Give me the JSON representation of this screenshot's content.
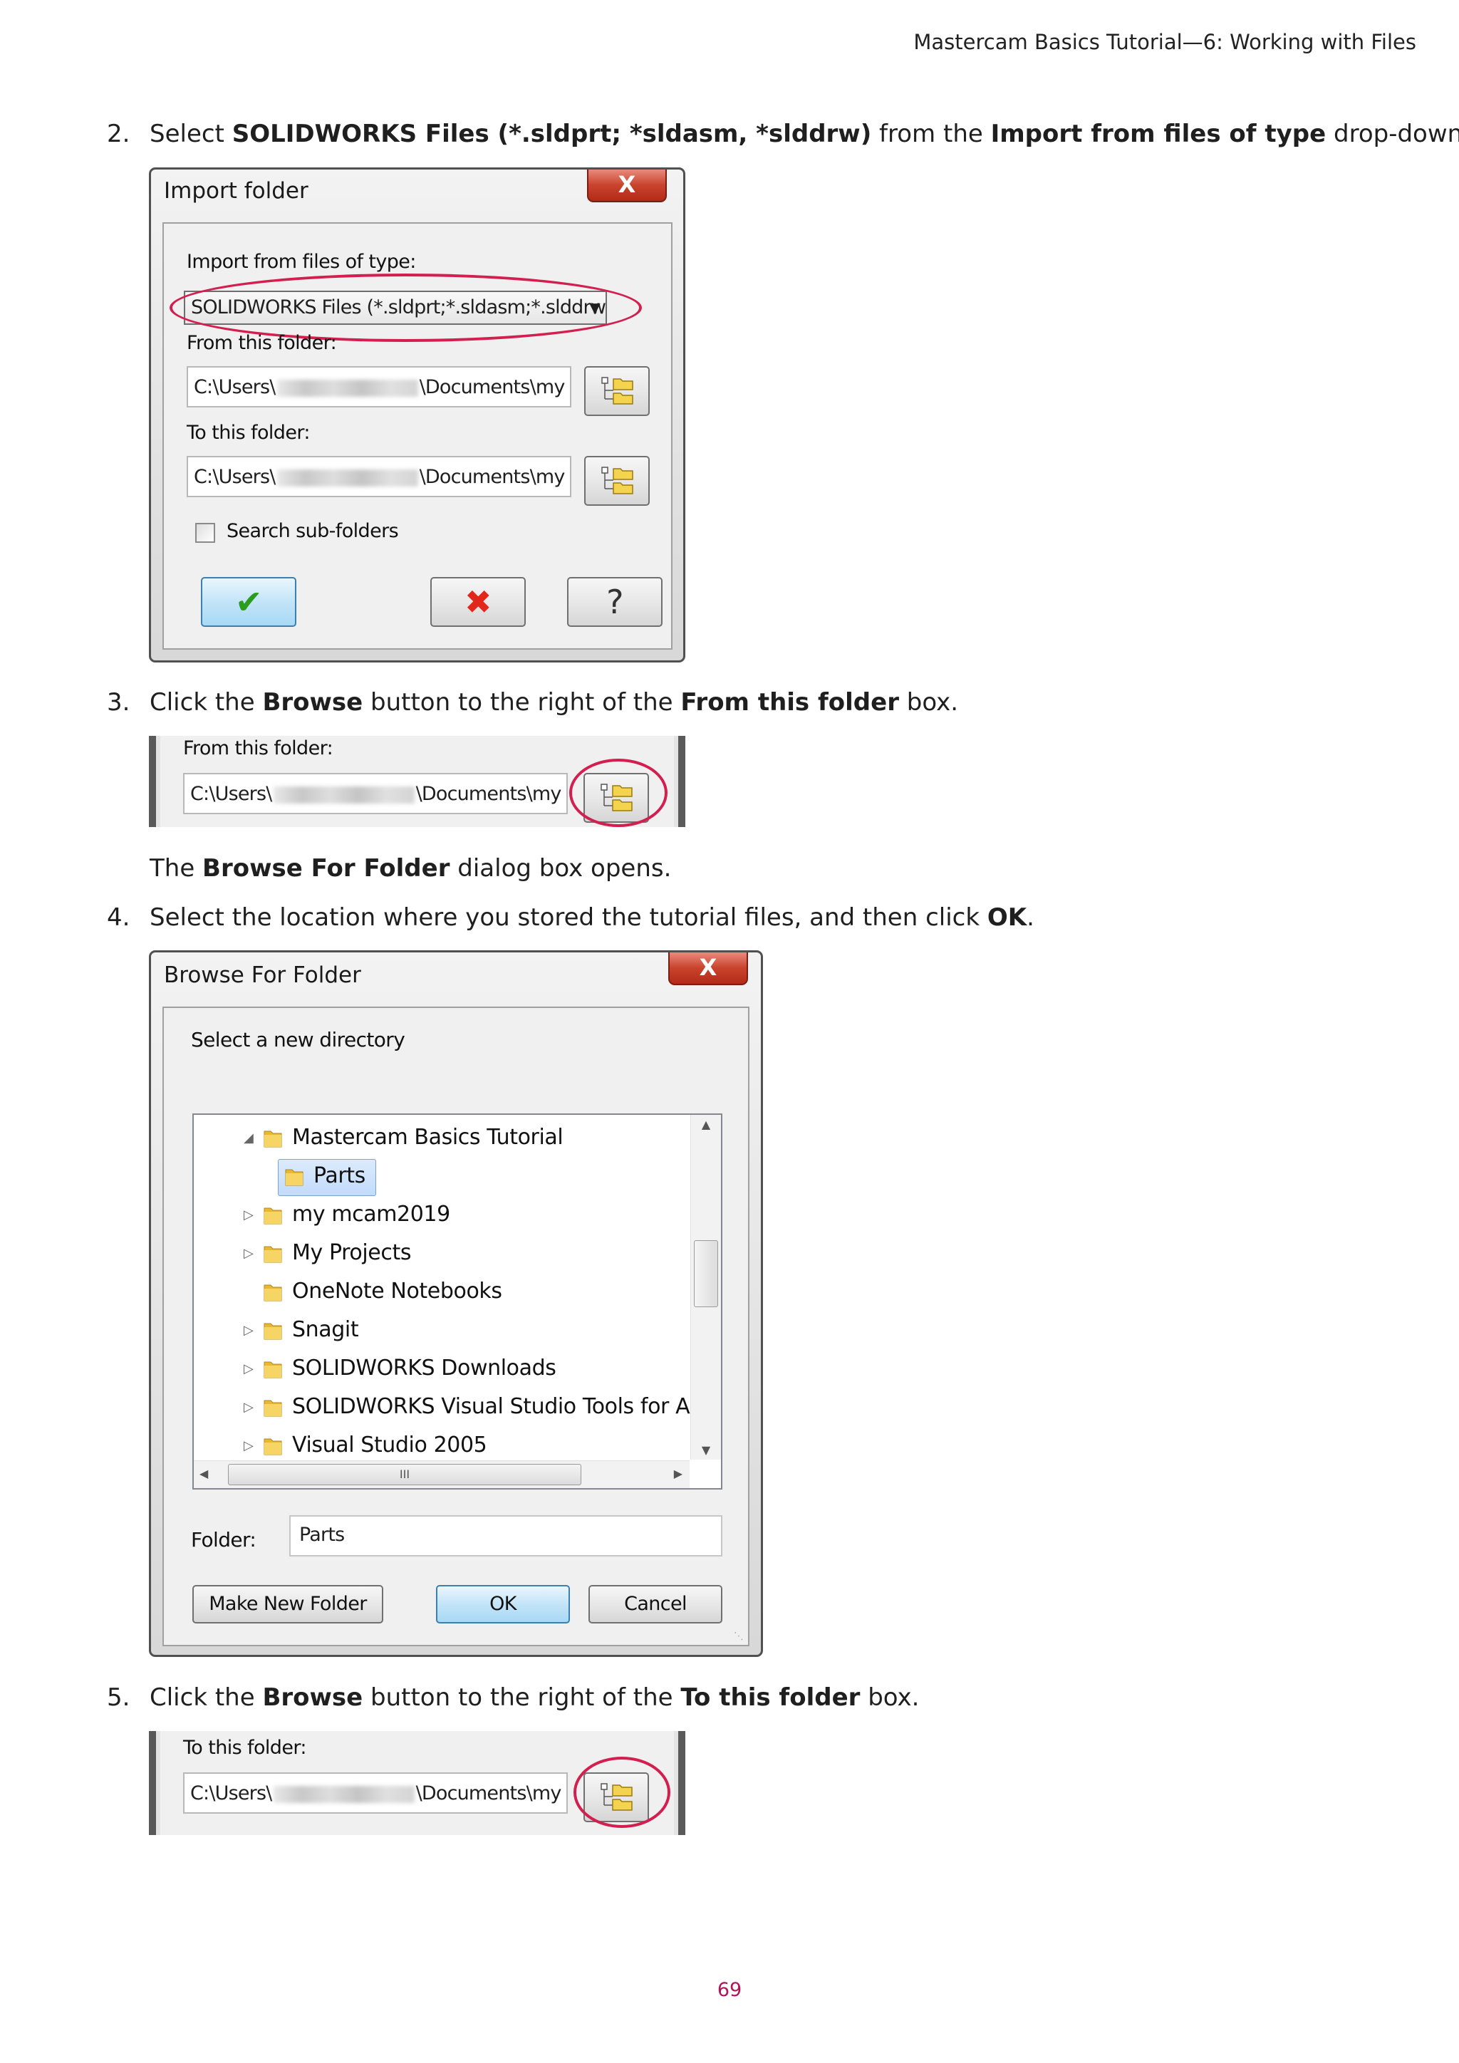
{
  "header": "Mastercam Basics Tutorial—6: Working with Files",
  "page_number": "69",
  "steps": [
    {
      "num": "2.",
      "parts": [
        "Select ",
        "SOLIDWORKS Files (*.sldprt; *sldasm, *slddrw)",
        " from the ",
        "Import from files of type",
        " drop-down."
      ]
    },
    {
      "num": "3.",
      "parts": [
        "Click the ",
        "Browse",
        " button to the right of the ",
        "From this folder",
        " box."
      ]
    },
    {
      "num": "4.",
      "parts": [
        "Select the location where you stored the tutorial files, and then click ",
        "OK",
        "."
      ]
    },
    {
      "num": "5.",
      "parts": [
        "Click the ",
        "Browse",
        " button to the right of the ",
        "To this folder",
        " box."
      ]
    }
  ],
  "note": {
    "parts": [
      "The ",
      "Browse For Folder",
      " dialog box opens."
    ]
  },
  "import_dialog": {
    "title": "Import folder",
    "close_glyph": "X",
    "type_label": "Import from files of type:",
    "type_value": "SOLIDWORKS Files (*.sldprt;*.sldasm;*.slddrw",
    "from_label": "From this folder:",
    "from_prefix": "C:\\Users\\",
    "from_suffix": "\\Documents\\my",
    "to_label": "To this folder:",
    "to_prefix": "C:\\Users\\",
    "to_suffix": "\\Documents\\my",
    "search_label": "Search sub-folders",
    "search_checked": false,
    "ok_glyph": "✔",
    "cancel_glyph": "✖",
    "help_glyph": "?"
  },
  "crop_from": {
    "label": "From this folder:",
    "prefix": "C:\\Users\\",
    "suffix": "\\Documents\\my"
  },
  "crop_to": {
    "label": "To this folder:",
    "prefix": "C:\\Users\\",
    "suffix": "\\Documents\\my"
  },
  "browse_dialog": {
    "title": "Browse For Folder",
    "close_glyph": "X",
    "instruction": "Select a new directory",
    "tree": [
      {
        "label": "Mastercam Basics Tutorial",
        "expander": "◢",
        "level": 0
      },
      {
        "label": "Parts",
        "expander": "",
        "level": 1,
        "selected": true
      },
      {
        "label": "my mcam2019",
        "expander": "▷",
        "level": 0
      },
      {
        "label": "My Projects",
        "expander": "▷",
        "level": 0
      },
      {
        "label": "OneNote Notebooks",
        "expander": "",
        "level": 0
      },
      {
        "label": "Snagit",
        "expander": "▷",
        "level": 0
      },
      {
        "label": "SOLIDWORKS Downloads",
        "expander": "▷",
        "level": 0
      },
      {
        "label": "SOLIDWORKS Visual Studio Tools for Ap",
        "expander": "▷",
        "level": 0
      },
      {
        "label": "Visual Studio 2005",
        "expander": "▷",
        "level": 0
      }
    ],
    "hscroll_grip": "III",
    "folder_label": "Folder:",
    "folder_value": "Parts",
    "make_new_folder": "Make New Folder",
    "ok": "OK",
    "cancel": "Cancel"
  },
  "colors": {
    "accent_ring": "#d21f4f",
    "page_number": "#b0155a"
  }
}
